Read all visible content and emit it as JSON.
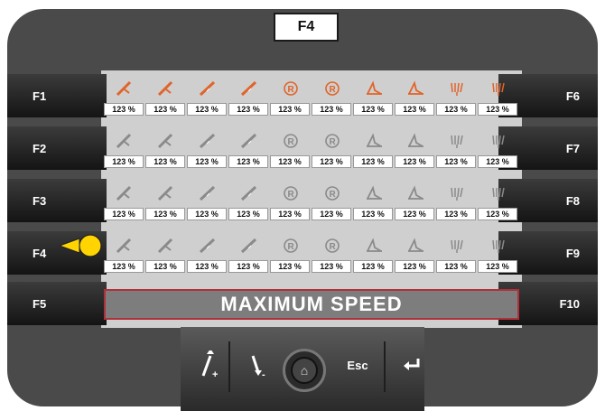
{
  "title": "F4",
  "left_keys": [
    "F1",
    "F2",
    "F3",
    "F4",
    "F5"
  ],
  "right_keys": [
    "F6",
    "F7",
    "F8",
    "F9",
    "F10"
  ],
  "rows": [
    {
      "active": true,
      "icons": [
        "knife-icon",
        "knife-icon",
        "scraper-icon",
        "scraper-icon",
        "registered-icon",
        "registered-icon",
        "angle-icon",
        "angle-icon",
        "comb-icon",
        "comb-icon"
      ],
      "values": [
        "123 %",
        "123 %",
        "123 %",
        "123 %",
        "123 %",
        "123 %",
        "123 %",
        "123 %",
        "123 %",
        "123 %"
      ]
    },
    {
      "active": false,
      "icons": [
        "knife-icon",
        "knife-icon",
        "scraper-icon",
        "scraper-icon",
        "registered-icon",
        "registered-icon",
        "angle-icon",
        "angle-icon",
        "comb-icon",
        "comb-icon"
      ],
      "values": [
        "123 %",
        "123 %",
        "123 %",
        "123 %",
        "123 %",
        "123 %",
        "123 %",
        "123 %",
        "123 %",
        "123 %"
      ]
    },
    {
      "active": false,
      "icons": [
        "knife-icon",
        "knife-icon",
        "scraper-icon",
        "scraper-icon",
        "registered-icon",
        "registered-icon",
        "angle-icon",
        "angle-icon",
        "comb-icon",
        "comb-icon"
      ],
      "values": [
        "123 %",
        "123 %",
        "123 %",
        "123 %",
        "123 %",
        "123 %",
        "123 %",
        "123 %",
        "123 %",
        "123 %"
      ]
    },
    {
      "active": false,
      "icons": [
        "knife-icon",
        "knife-icon",
        "scraper-icon",
        "scraper-icon",
        "registered-icon",
        "registered-icon",
        "angle-icon",
        "angle-icon",
        "comb-icon",
        "comb-icon"
      ],
      "values": [
        "123 %",
        "123 %",
        "123 %",
        "123 %",
        "123 %",
        "123 %",
        "123 %",
        "123 %",
        "123 %",
        "123 %"
      ]
    }
  ],
  "status": "MAXIMUM SPEED",
  "bottom": {
    "up_label": "+",
    "down_label": "-",
    "esc_label": "Esc"
  },
  "colors": {
    "active_icon": "#e0642a",
    "inactive_icon": "#8a8a8a",
    "status_border": "#b0303a",
    "cursor": "#ffd400"
  }
}
